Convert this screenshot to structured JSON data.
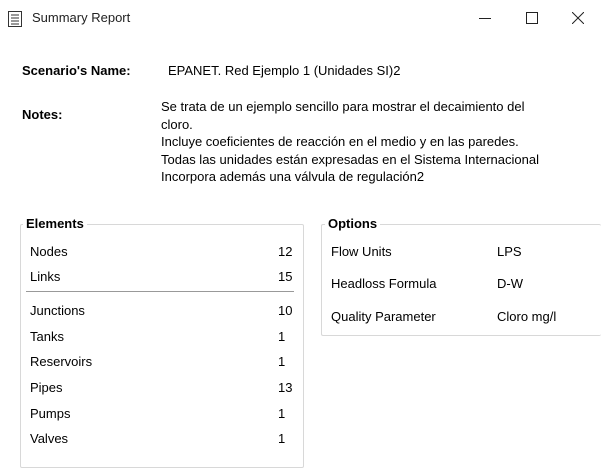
{
  "window": {
    "title": "Summary Report"
  },
  "scenario": {
    "label": "Scenario's Name:",
    "value": "EPANET. Red Ejemplo 1 (Unidades SI)2"
  },
  "notes": {
    "label": "Notes:",
    "lines": [
      "Se trata de un ejemplo sencillo para mostrar el decaimiento del",
      "cloro.",
      "Incluye coeficientes de reacción en el medio y en las paredes.",
      "Todas las unidades están expresadas en el Sistema Internacional",
      "Incorpora además una válvula de regulación2"
    ]
  },
  "elements": {
    "title": "Elements",
    "rows": [
      {
        "label": "Nodes",
        "value": "12"
      },
      {
        "label": "Links",
        "value": "15"
      },
      {
        "label": "Junctions",
        "value": "10"
      },
      {
        "label": "Tanks",
        "value": "1"
      },
      {
        "label": "Reservoirs",
        "value": "1"
      },
      {
        "label": "Pipes",
        "value": "13"
      },
      {
        "label": "Pumps",
        "value": "1"
      },
      {
        "label": "Valves",
        "value": "1"
      }
    ]
  },
  "options": {
    "title": "Options",
    "rows": [
      {
        "label": "Flow Units",
        "value": "LPS"
      },
      {
        "label": "Headloss Formula",
        "value": "D-W"
      },
      {
        "label": "Quality Parameter",
        "value": "Cloro mg/l"
      }
    ]
  },
  "icons": {
    "app": "report-icon",
    "minimize": "minimize-icon",
    "maximize": "maximize-icon",
    "close": "close-icon"
  }
}
